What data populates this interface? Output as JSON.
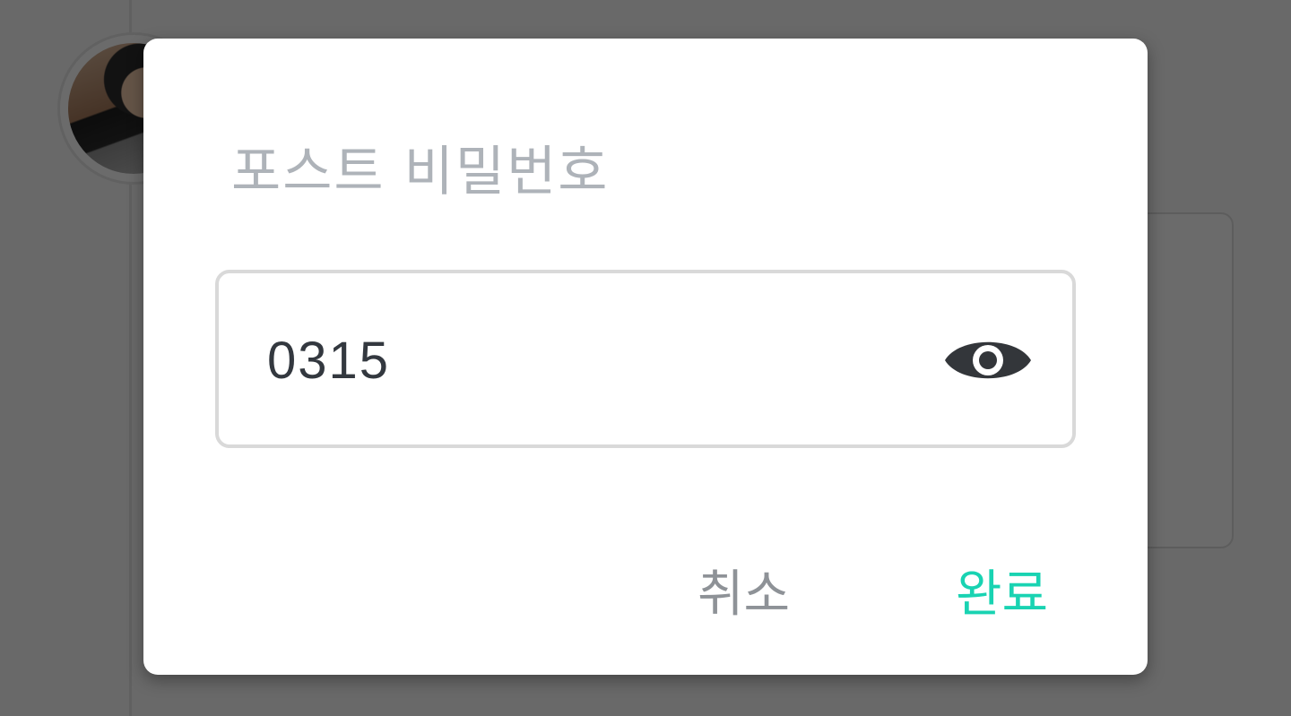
{
  "dialog": {
    "title": "포스트 비밀번호",
    "password_value": "0315",
    "toggle_icon": "eye-icon",
    "cancel_label": "취소",
    "done_label": "완료"
  },
  "colors": {
    "accent": "#19d3b2",
    "title_gray": "#aeb3b9",
    "cancel_gray": "#8e9297",
    "text_dark": "#33383f",
    "scrim": "rgba(0,0,0,0.57)"
  }
}
